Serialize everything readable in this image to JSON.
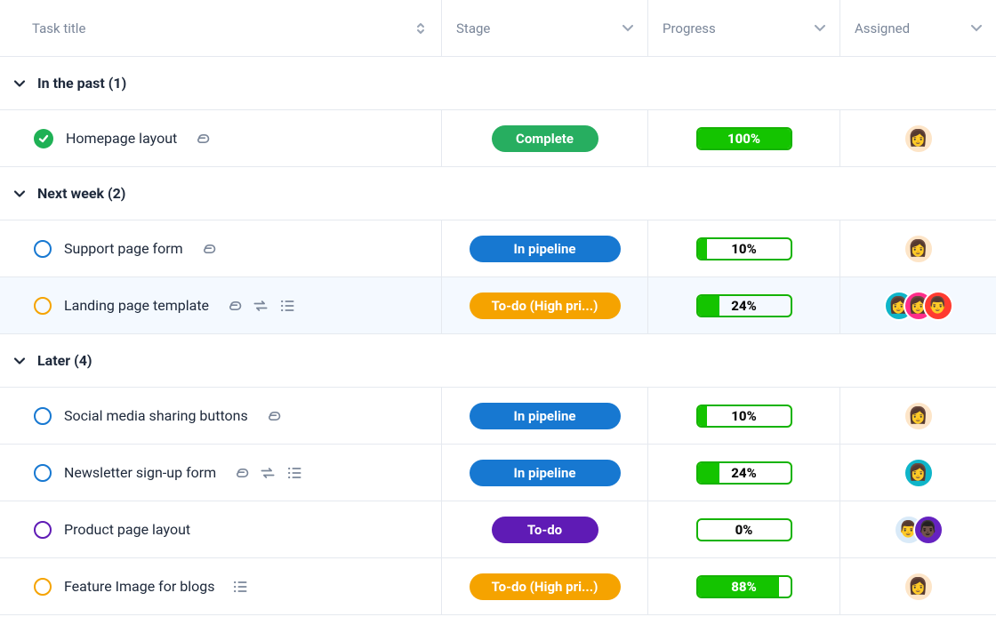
{
  "columns": {
    "title": "Task title",
    "stage": "Stage",
    "progress": "Progress",
    "assigned": "Assigned"
  },
  "status_colors": {
    "ring_blue": "#1778d1",
    "ring_orange": "#f5a300",
    "ring_purple": "#5f1bb5",
    "check_green": "#1fb155"
  },
  "groups": [
    {
      "label": "In the past (1)",
      "tasks": [
        {
          "title": "Homepage layout",
          "status_kind": "check",
          "status_color": "check_green",
          "icons": [
            "attachment"
          ],
          "stage_label": "Complete",
          "stage_class": "stage-complete",
          "progress_pct": 100,
          "progress_label": "100%",
          "assignees": [
            {
              "bg": "av-bg-1",
              "emoji": "👩"
            }
          ],
          "highlight": false
        }
      ]
    },
    {
      "label": "Next week (2)",
      "tasks": [
        {
          "title": "Support page form",
          "status_kind": "ring",
          "status_color": "ring_blue",
          "icons": [
            "attachment"
          ],
          "stage_label": "In pipeline",
          "stage_class": "stage-inpipeline",
          "progress_pct": 10,
          "progress_label": "10%",
          "assignees": [
            {
              "bg": "av-bg-1",
              "emoji": "👩"
            }
          ],
          "highlight": false
        },
        {
          "title": "Landing page template",
          "status_kind": "ring",
          "status_color": "ring_orange",
          "icons": [
            "attachment",
            "recurring",
            "subtasks"
          ],
          "stage_label": "To-do (High pri...)",
          "stage_class": "stage-todohigh",
          "progress_pct": 24,
          "progress_label": "24%",
          "assignees": [
            {
              "bg": "av-bg-2",
              "emoji": "👩"
            },
            {
              "bg": "av-bg-3",
              "emoji": "👩"
            },
            {
              "bg": "av-bg-4",
              "emoji": "👨"
            }
          ],
          "highlight": true
        }
      ]
    },
    {
      "label": "Later (4)",
      "tasks": [
        {
          "title": "Social media sharing buttons",
          "status_kind": "ring",
          "status_color": "ring_blue",
          "icons": [
            "attachment"
          ],
          "stage_label": "In pipeline",
          "stage_class": "stage-inpipeline",
          "progress_pct": 10,
          "progress_label": "10%",
          "assignees": [
            {
              "bg": "av-bg-1",
              "emoji": "👩"
            }
          ],
          "highlight": false
        },
        {
          "title": "Newsletter sign-up form",
          "status_kind": "ring",
          "status_color": "ring_blue",
          "icons": [
            "attachment",
            "recurring",
            "subtasks"
          ],
          "stage_label": "In pipeline",
          "stage_class": "stage-inpipeline",
          "progress_pct": 24,
          "progress_label": "24%",
          "assignees": [
            {
              "bg": "av-bg-2",
              "emoji": "👩"
            }
          ],
          "highlight": false
        },
        {
          "title": "Product page layout",
          "status_kind": "ring",
          "status_color": "ring_purple",
          "icons": [],
          "stage_label": "To-do",
          "stage_class": "stage-todo",
          "progress_pct": 0,
          "progress_label": "0%",
          "assignees": [
            {
              "bg": "av-bg-5",
              "emoji": "👨"
            },
            {
              "bg": "av-bg-6",
              "emoji": "👨🏿"
            }
          ],
          "highlight": false
        },
        {
          "title": "Feature Image for blogs",
          "status_kind": "ring",
          "status_color": "ring_orange",
          "icons": [
            "subtasks"
          ],
          "stage_label": "To-do (High pri...)",
          "stage_class": "stage-todohigh",
          "progress_pct": 88,
          "progress_label": "88%",
          "assignees": [
            {
              "bg": "av-bg-1",
              "emoji": "👩"
            }
          ],
          "highlight": false
        }
      ]
    }
  ]
}
